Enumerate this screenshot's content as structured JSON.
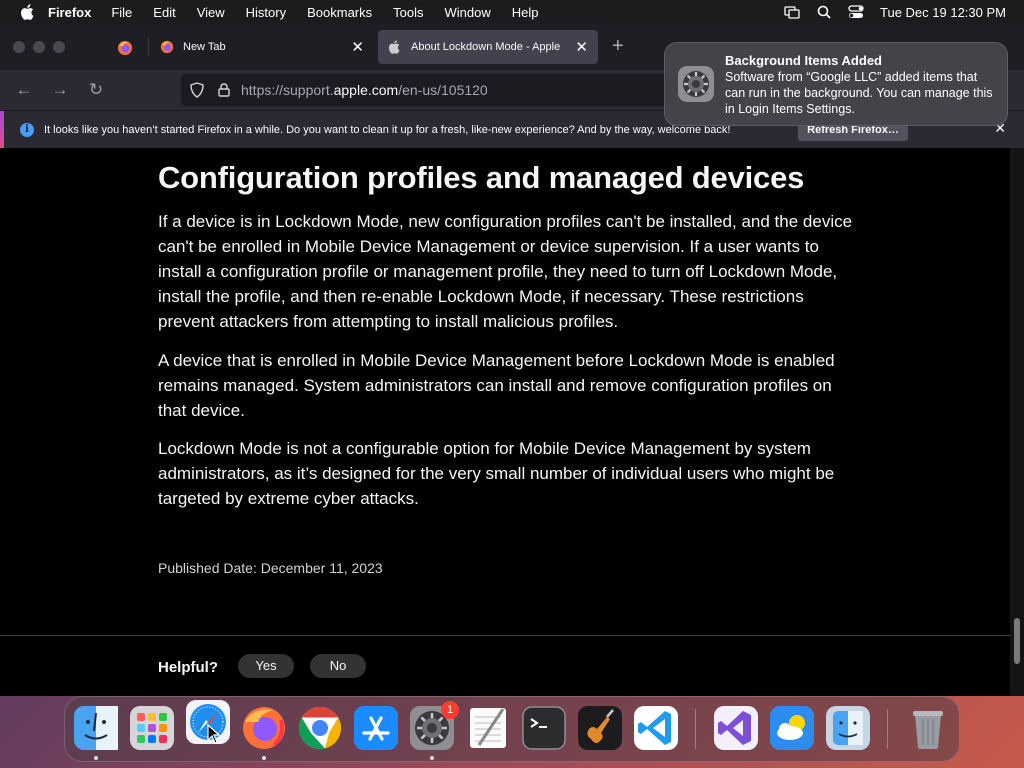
{
  "menubar": {
    "app_name": "Firefox",
    "items": [
      "File",
      "Edit",
      "View",
      "History",
      "Bookmarks",
      "Tools",
      "Window",
      "Help"
    ],
    "clock": "Tue Dec 19  12:30 PM"
  },
  "tabs": [
    {
      "title": "New Tab",
      "icon": "firefox-icon",
      "active": false
    },
    {
      "title": "About Lockdown Mode - Apple",
      "icon": "apple-icon",
      "active": true
    }
  ],
  "url": {
    "prefix": "https://support.",
    "host": "apple.com",
    "path": "/en-us/105120"
  },
  "infobar": {
    "message": "It looks like you haven’t started Firefox in a while. Do you want to clean it up for a fresh, like-new experience? And by the way, welcome back!",
    "button": "Refresh Firefox…"
  },
  "notification": {
    "title": "Background Items Added",
    "body": "Software from “Google LLC” added items that can run in the background. You can manage this in Login Items Settings."
  },
  "article": {
    "heading": "Configuration profiles and managed devices",
    "paragraphs": [
      "If a device is in Lockdown Mode, new configuration profiles can't be installed, and the device can't be enrolled in Mobile Device Management or device supervision. If a user wants to install a configuration profile or management profile, they need to turn off Lockdown Mode, install the profile, and then re-enable Lockdown Mode, if necessary. These restrictions prevent attackers from attempting to install malicious profiles.",
      "A device that is enrolled in Mobile Device Management before Lockdown Mode is enabled remains managed. System administrators can install and remove configuration profiles on that device.",
      "Lockdown Mode is not a configurable option for Mobile Device Management by system administrators, as it’s designed for the very small number of individual users who might be targeted by extreme cyber attacks."
    ],
    "published": "Published Date: December 11, 2023",
    "helpful_label": "Helpful?",
    "yes_label": "Yes",
    "no_label": "No"
  },
  "dock": {
    "apps": [
      "finder-icon",
      "launchpad-icon",
      "safari-icon",
      "firefox-icon",
      "chrome-icon",
      "app-store-icon",
      "system-settings-icon",
      "textedit-icon",
      "terminal-icon",
      "garageband-icon",
      "vscode-icon",
      "visual-studio-icon",
      "weather-icon",
      "finder-alt-icon",
      "trash-icon"
    ],
    "settings_badge": "1"
  }
}
